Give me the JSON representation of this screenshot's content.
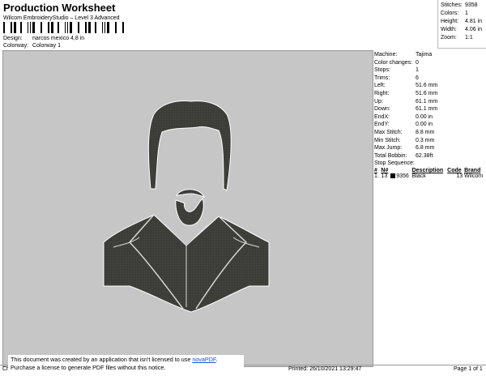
{
  "header": {
    "title": "Production Worksheet",
    "subtitle": "Wilcom EmbroideryStudio – Level 3 Advanced",
    "design_label": "Design:",
    "design_value": "narcos mexico 4,8 in",
    "colorway_label": "Colorway:",
    "colorway_value": "Colorway 1"
  },
  "stats": [
    {
      "label": "Stitches:",
      "value": "9358"
    },
    {
      "label": "Colors:",
      "value": "1"
    },
    {
      "label": "Height:",
      "value": "4.81 in"
    },
    {
      "label": "Width:",
      "value": "4.06 in"
    },
    {
      "label": "Zoom:",
      "value": "1:1"
    }
  ],
  "machine_info": [
    {
      "label": "Machine:",
      "value": "Tajima"
    },
    {
      "label": "Color changes:",
      "value": "0"
    },
    {
      "label": "Stops:",
      "value": "1"
    },
    {
      "label": "Trims:",
      "value": "6"
    },
    {
      "label": "Left:",
      "value": "51.6 mm"
    },
    {
      "label": "Right:",
      "value": "51.6 mm"
    },
    {
      "label": "Up:",
      "value": "61.1 mm"
    },
    {
      "label": "Down:",
      "value": "61.1 mm"
    },
    {
      "label": "EndX:",
      "value": "0.00 in"
    },
    {
      "label": "EndY:",
      "value": "0.00 in"
    },
    {
      "label": "Max Stitch:",
      "value": "8.8 mm"
    },
    {
      "label": "Min Stitch:",
      "value": "0.3 mm"
    },
    {
      "label": "Max Jump:",
      "value": "6.8 mm"
    },
    {
      "label": "Total Bobbin:",
      "value": "62.38ft"
    }
  ],
  "stop_sequence": {
    "title": "Stop Sequence:",
    "columns": [
      "#",
      "N#",
      "",
      "Description",
      "Code",
      "Brand"
    ],
    "rows": [
      {
        "num": "1.",
        "n": "13",
        "stitches": "9356",
        "description": "Black",
        "code": "13",
        "brand": "Wilcom",
        "color": "#000000"
      }
    ]
  },
  "notice": {
    "line1": "This document was created by an application that isn't licensed to use ",
    "link": "novaPDF",
    "line1_end": ".",
    "line2": "Purchase a license to generate PDF files without this notice."
  },
  "footer": {
    "left": "Cr",
    "printed": "Printed: 26/10/2021 13:29:47",
    "page": "Page 1 of 1"
  },
  "colors": {
    "thread": "#3a3a36",
    "background": "#c6c6c6"
  }
}
